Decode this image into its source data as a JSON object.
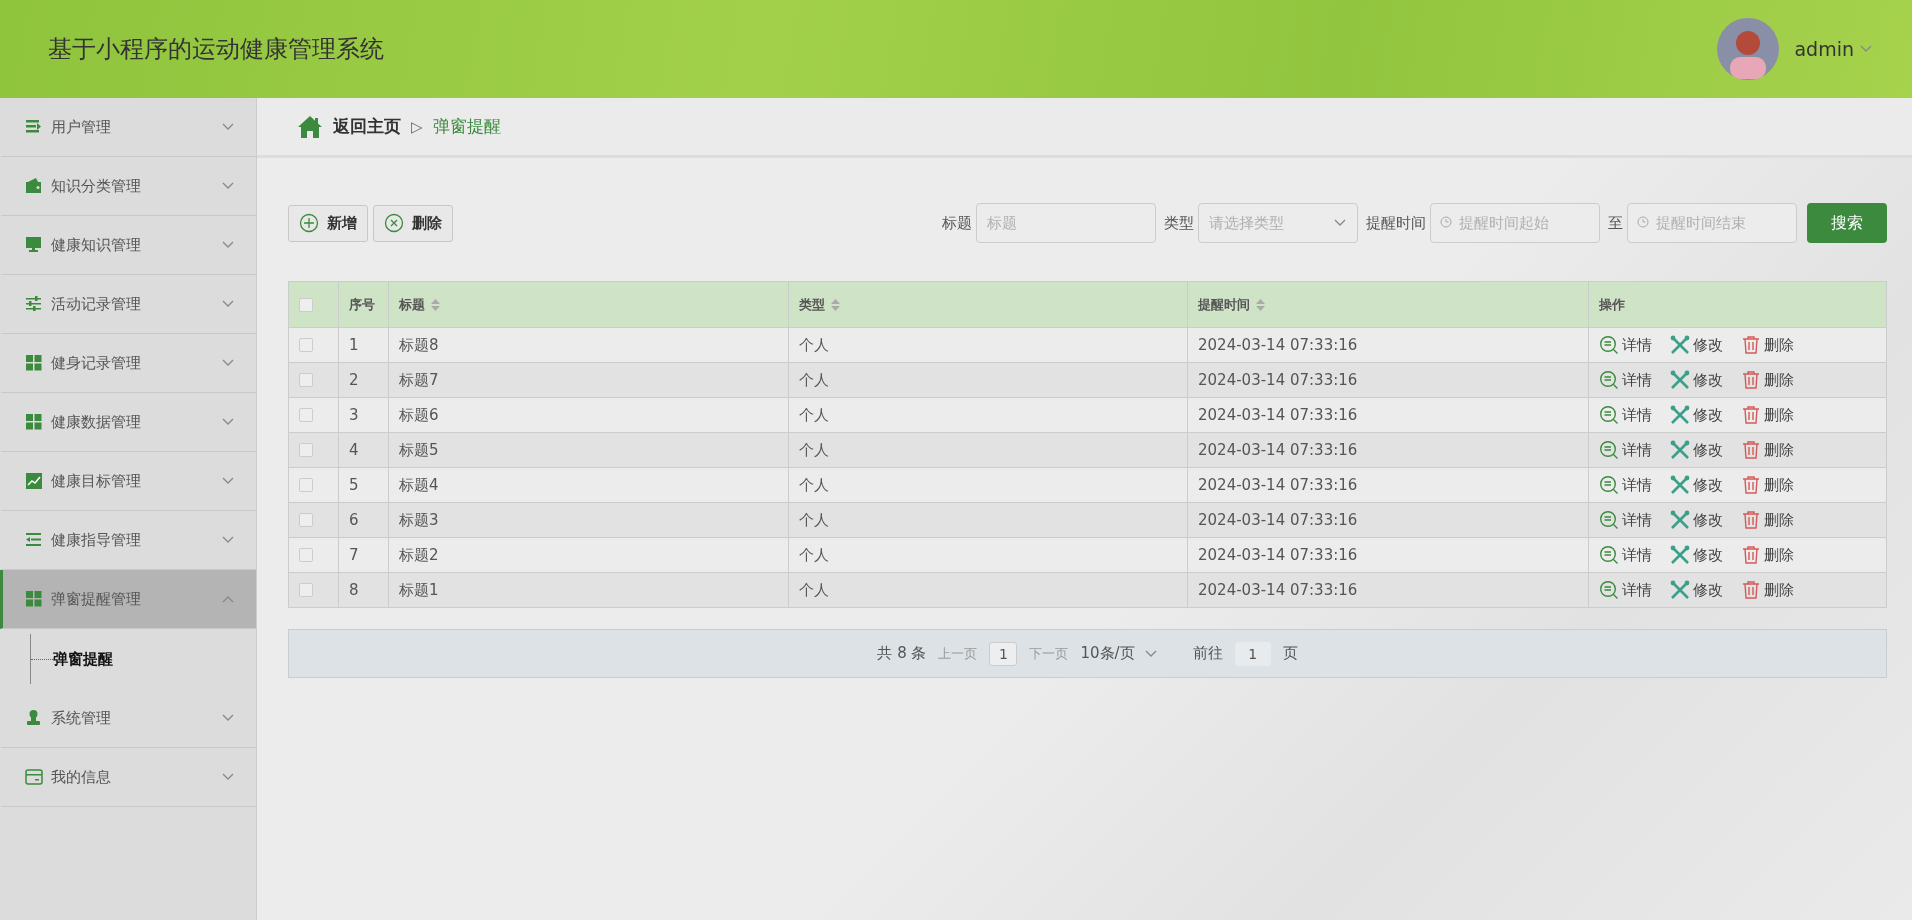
{
  "header": {
    "title": "基于小程序的运动健康管理系统",
    "user": "admin"
  },
  "sidebar": {
    "items": [
      {
        "label": "用户管理",
        "kind": "list",
        "expanded": false
      },
      {
        "label": "知识分类管理",
        "kind": "wallet",
        "expanded": false
      },
      {
        "label": "健康知识管理",
        "kind": "monitor",
        "expanded": false
      },
      {
        "label": "活动记录管理",
        "kind": "sliders",
        "expanded": false
      },
      {
        "label": "健身记录管理",
        "kind": "grid",
        "expanded": false
      },
      {
        "label": "健康数据管理",
        "kind": "grid",
        "expanded": false
      },
      {
        "label": "健康目标管理",
        "kind": "chart",
        "expanded": false
      },
      {
        "label": "健康指导管理",
        "kind": "indent",
        "expanded": false
      },
      {
        "label": "弹窗提醒管理",
        "kind": "grid",
        "expanded": true,
        "children": [
          {
            "label": "弹窗提醒",
            "selected": true
          }
        ]
      },
      {
        "label": "系统管理",
        "kind": "user",
        "expanded": false
      },
      {
        "label": "我的信息",
        "kind": "card",
        "expanded": false
      }
    ]
  },
  "breadcrumb": {
    "home": "返回主页",
    "separator": "▷",
    "current": "弹窗提醒"
  },
  "toolbar": {
    "buttons": [
      {
        "label": "新增",
        "kind": "add"
      },
      {
        "label": "删除",
        "kind": "remove"
      }
    ]
  },
  "search": {
    "fields": [
      {
        "label": "标题",
        "placeholder": "标题",
        "kind": "text"
      },
      {
        "label": "类型",
        "placeholder": "请选择类型",
        "kind": "select"
      },
      {
        "label": "提醒时间",
        "placeholder": "提醒时间起始",
        "kind": "date"
      },
      {
        "label": "至",
        "placeholder": "提醒时间结束",
        "kind": "date"
      }
    ],
    "button": "搜索"
  },
  "table": {
    "all_checked": false,
    "columns": [
      {
        "label": "序号",
        "sortable": false
      },
      {
        "label": "标题",
        "sortable": true
      },
      {
        "label": "类型",
        "sortable": true
      },
      {
        "label": "提醒时间",
        "sortable": true
      },
      {
        "label": "操作",
        "sortable": false
      }
    ],
    "rows": [
      {
        "checked": false,
        "index": "1",
        "title": "标题8",
        "type": "个人",
        "time": "2024-03-14 07:33:16",
        "actions": [
          {
            "label": "详情",
            "kind": "detail"
          },
          {
            "label": "修改",
            "kind": "edit"
          },
          {
            "label": "删除",
            "kind": "delete"
          }
        ]
      },
      {
        "checked": false,
        "index": "2",
        "title": "标题7",
        "type": "个人",
        "time": "2024-03-14 07:33:16",
        "actions": [
          {
            "label": "详情",
            "kind": "detail"
          },
          {
            "label": "修改",
            "kind": "edit"
          },
          {
            "label": "删除",
            "kind": "delete"
          }
        ]
      },
      {
        "checked": false,
        "index": "3",
        "title": "标题6",
        "type": "个人",
        "time": "2024-03-14 07:33:16",
        "actions": [
          {
            "label": "详情",
            "kind": "detail"
          },
          {
            "label": "修改",
            "kind": "edit"
          },
          {
            "label": "删除",
            "kind": "delete"
          }
        ]
      },
      {
        "checked": false,
        "index": "4",
        "title": "标题5",
        "type": "个人",
        "time": "2024-03-14 07:33:16",
        "actions": [
          {
            "label": "详情",
            "kind": "detail"
          },
          {
            "label": "修改",
            "kind": "edit"
          },
          {
            "label": "删除",
            "kind": "delete"
          }
        ]
      },
      {
        "checked": false,
        "index": "5",
        "title": "标题4",
        "type": "个人",
        "time": "2024-03-14 07:33:16",
        "actions": [
          {
            "label": "详情",
            "kind": "detail"
          },
          {
            "label": "修改",
            "kind": "edit"
          },
          {
            "label": "删除",
            "kind": "delete"
          }
        ]
      },
      {
        "checked": false,
        "index": "6",
        "title": "标题3",
        "type": "个人",
        "time": "2024-03-14 07:33:16",
        "actions": [
          {
            "label": "详情",
            "kind": "detail"
          },
          {
            "label": "修改",
            "kind": "edit"
          },
          {
            "label": "删除",
            "kind": "delete"
          }
        ]
      },
      {
        "checked": false,
        "index": "7",
        "title": "标题2",
        "type": "个人",
        "time": "2024-03-14 07:33:16",
        "actions": [
          {
            "label": "详情",
            "kind": "detail"
          },
          {
            "label": "修改",
            "kind": "edit"
          },
          {
            "label": "删除",
            "kind": "delete"
          }
        ]
      },
      {
        "checked": false,
        "index": "8",
        "title": "标题1",
        "type": "个人",
        "time": "2024-03-14 07:33:16",
        "actions": [
          {
            "label": "详情",
            "kind": "detail"
          },
          {
            "label": "修改",
            "kind": "edit"
          },
          {
            "label": "删除",
            "kind": "delete"
          }
        ]
      }
    ]
  },
  "pagination": {
    "total": "共 8 条",
    "prev": "上一页",
    "page": "1",
    "next": "下一页",
    "page_size": "10条/页",
    "goto": "前往",
    "goto_value": "1",
    "goto_unit": "页"
  }
}
